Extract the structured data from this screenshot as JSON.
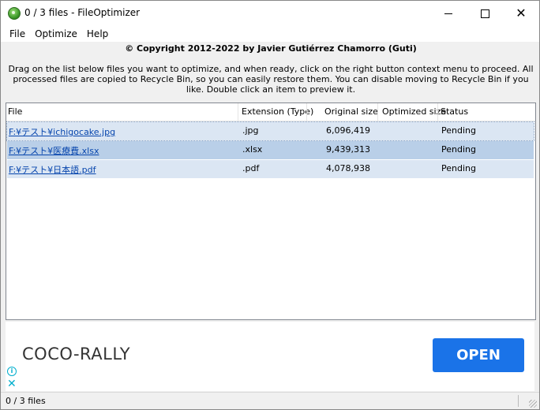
{
  "window": {
    "title": "0 / 3 files - FileOptimizer",
    "min_icon": "minimize-icon",
    "max_icon": "maximize-icon",
    "close_icon": "close-icon",
    "close_glyph": "✕"
  },
  "menu": [
    "File",
    "Optimize",
    "Help"
  ],
  "copyright": "© Copyright 2012-2022 by Javier Gutiérrez Chamorro (Guti)",
  "description": "Drag on the list below files you want to optimize, and when ready, click on the right button context menu to proceed. All processed files are copied to Recycle Bin, so you can easily restore them. You can disable moving to Recycle Bin if you like. Double click an item to preview it.",
  "list": {
    "columns": [
      "File",
      "Extension (Type)",
      "Original size",
      "Optimized size",
      "Status"
    ],
    "rows": [
      {
        "file": "F:¥テスト¥ichigocake.jpg",
        "ext": ".jpg",
        "original": "6,096,419",
        "optimized": "",
        "status": "Pending"
      },
      {
        "file": "F:¥テスト¥医療費.xlsx",
        "ext": ".xlsx",
        "original": "9,439,313",
        "optimized": "",
        "status": "Pending"
      },
      {
        "file": "F:¥テスト¥日本語.pdf",
        "ext": ".pdf",
        "original": "4,078,938",
        "optimized": "",
        "status": "Pending"
      }
    ]
  },
  "ad": {
    "name": "COCO-RALLY",
    "button": "OPEN",
    "info_glyph": "i",
    "close_glyph": "✕",
    "button_color": "#1a73e8"
  },
  "statusbar": {
    "text": "0 / 3 files"
  }
}
